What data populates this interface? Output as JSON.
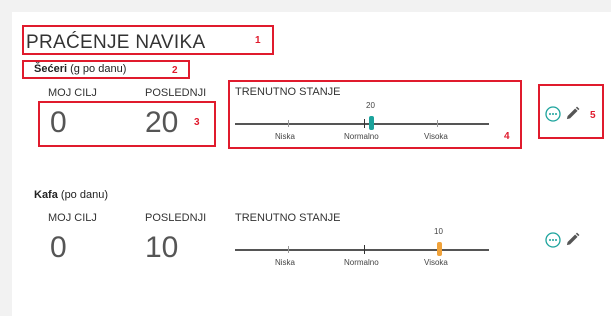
{
  "header": {
    "title": "PRAĆENJE NAVIKA"
  },
  "colors": {
    "sugar_marker": "#1ba39c",
    "coffee_marker": "#f0a23a",
    "annotation": "#e01b2d"
  },
  "annotations": [
    "1",
    "2",
    "3",
    "4",
    "5"
  ],
  "habits": [
    {
      "name": "Šećeri",
      "unit": "(g po danu)",
      "goal_label": "MOJ CILJ",
      "last_label": "POSLEDNJI",
      "goal_value": "0",
      "last_value": "20",
      "status_label": "TRENUTNO STANJE",
      "status_value": "20",
      "scale_labels": [
        "Niska",
        "Normalno",
        "Visoka"
      ],
      "level": "Normalno",
      "icons": [
        "more-options-icon",
        "edit-icon"
      ]
    },
    {
      "name": "Kafa",
      "unit": "(po danu)",
      "goal_label": "MOJ CILJ",
      "last_label": "POSLEDNJI",
      "goal_value": "0",
      "last_value": "10",
      "status_label": "TRENUTNO STANJE",
      "status_value": "10",
      "scale_labels": [
        "Niska",
        "Normalno",
        "Visoka"
      ],
      "level": "Visoka",
      "icons": [
        "more-options-icon",
        "edit-icon"
      ]
    }
  ]
}
